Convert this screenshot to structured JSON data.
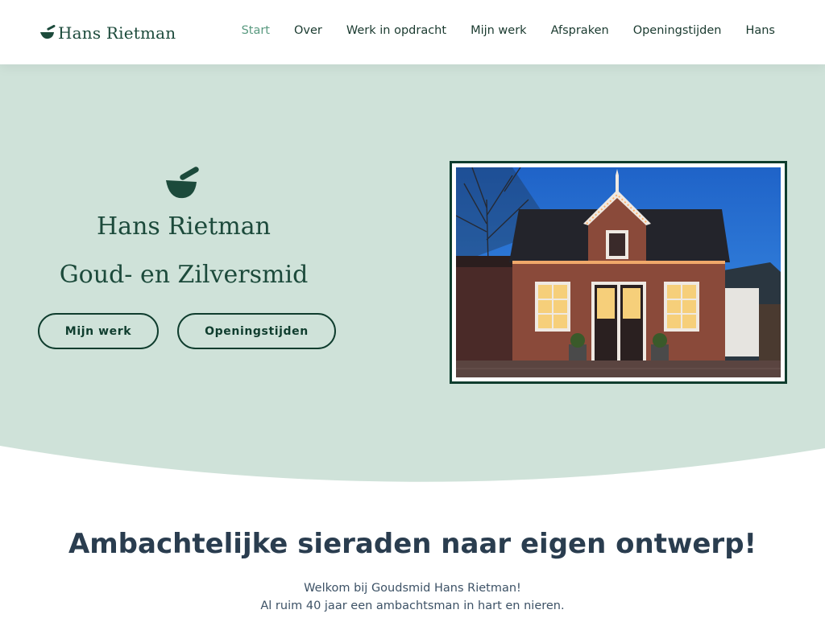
{
  "header": {
    "logo_text": "Hans Rietman",
    "nav": [
      {
        "label": "Start",
        "active": true
      },
      {
        "label": "Over"
      },
      {
        "label": "Werk in opdracht"
      },
      {
        "label": "Mijn werk"
      },
      {
        "label": "Afspraken"
      },
      {
        "label": "Openingstijden"
      },
      {
        "label": "Hans"
      }
    ]
  },
  "hero": {
    "name": "Hans Rietman",
    "subtitle": "Goud- en Zilversmid",
    "buttons": {
      "work": "Mijn werk",
      "hours": "Openingstijden"
    }
  },
  "content": {
    "headline": "Ambachtelijke sieraden naar eigen ontwerp!",
    "intro_line1": "Welkom bij Goudsmid Hans Rietman!",
    "intro_line2": "Al ruim 40 jaar een ambachtsman in hart en nieren."
  },
  "colors": {
    "brand_green": "#1c4a3b",
    "hero_background": "#cfe2d9",
    "nav_active": "#5a9a80",
    "headline_text": "#2a3d4f"
  },
  "icons": {
    "logo": "mortar-pestle-icon",
    "hero_mark": "mortar-pestle-icon"
  }
}
